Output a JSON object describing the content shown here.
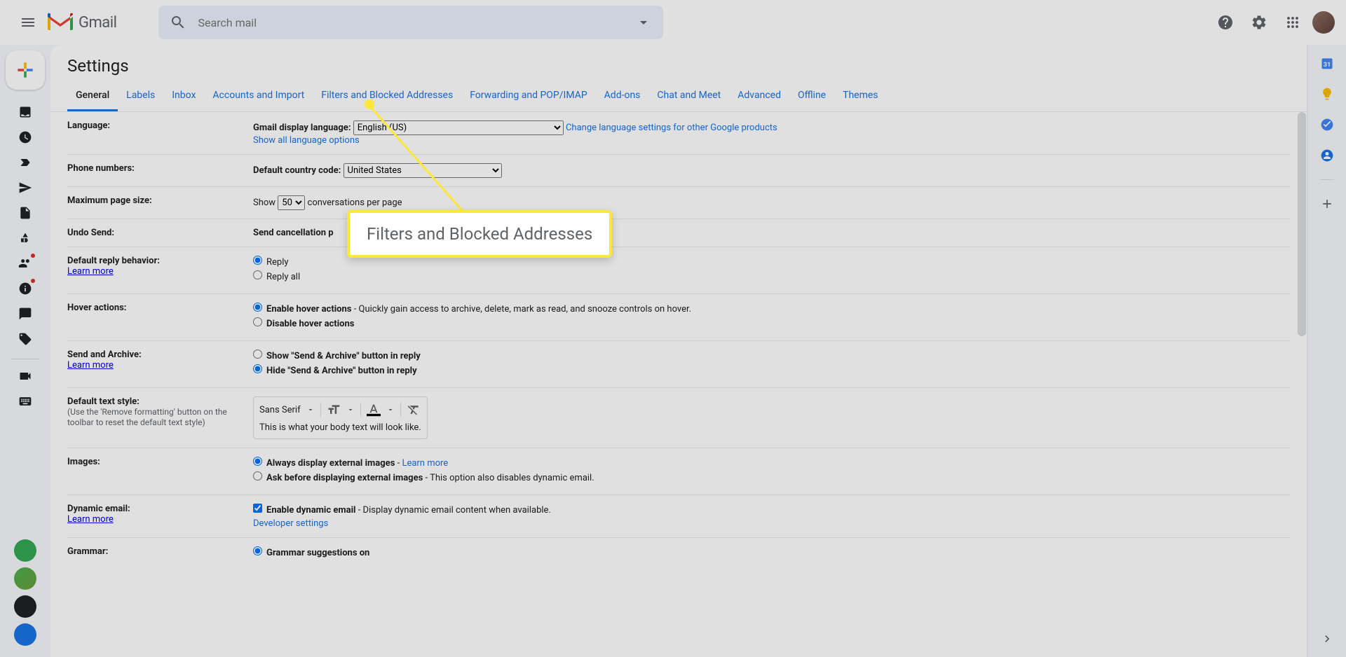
{
  "header": {
    "logo_text": "Gmail",
    "search_placeholder": "Search mail"
  },
  "sidebar": {
    "compose": "Compose"
  },
  "settings": {
    "title": "Settings",
    "tabs": [
      "General",
      "Labels",
      "Inbox",
      "Accounts and Import",
      "Filters and Blocked Addresses",
      "Forwarding and POP/IMAP",
      "Add-ons",
      "Chat and Meet",
      "Advanced",
      "Offline",
      "Themes"
    ],
    "active_tab": 0,
    "rows": {
      "language": {
        "label": "Language:",
        "display_lang_label": "Gmail display language:",
        "lang_value": "English (US)",
        "change_link": "Change language settings for other Google products",
        "show_all": "Show all language options"
      },
      "phone": {
        "label": "Phone numbers:",
        "country_label": "Default country code:",
        "country_value": "United States"
      },
      "pagesize": {
        "label": "Maximum page size:",
        "show": "Show",
        "size_value": "50",
        "suffix": "conversations per page"
      },
      "undo": {
        "label": "Undo Send:",
        "cancel_label": "Send cancellation p"
      },
      "reply": {
        "label": "Default reply behavior:",
        "learn_more": "Learn more",
        "opt1": "Reply",
        "opt2": "Reply all"
      },
      "hover": {
        "label": "Hover actions:",
        "opt1": "Enable hover actions",
        "opt1_desc": " - Quickly gain access to archive, delete, mark as read, and snooze controls on hover.",
        "opt2": "Disable hover actions"
      },
      "archive": {
        "label": "Send and Archive:",
        "learn_more": "Learn more",
        "opt1": "Show \"Send & Archive\" button in reply",
        "opt2": "Hide \"Send & Archive\" button in reply"
      },
      "textstyle": {
        "label": "Default text style:",
        "sub": "(Use the 'Remove formatting' button on the toolbar to reset the default text style)",
        "font": "Sans Serif",
        "preview": "This is what your body text will look like."
      },
      "images": {
        "label": "Images:",
        "opt1": "Always display external images",
        "opt1_link": "Learn more",
        "opt2": "Ask before displaying external images",
        "opt2_desc": " - This option also disables dynamic email."
      },
      "dynamic": {
        "label": "Dynamic email:",
        "learn_more": "Learn more",
        "opt1": "Enable dynamic email",
        "opt1_desc": " - Display dynamic email content when available.",
        "dev_link": "Developer settings"
      },
      "grammar": {
        "label": "Grammar:",
        "opt1": "Grammar suggestions on"
      }
    }
  },
  "callout": {
    "text": "Filters and Blocked Addresses"
  }
}
